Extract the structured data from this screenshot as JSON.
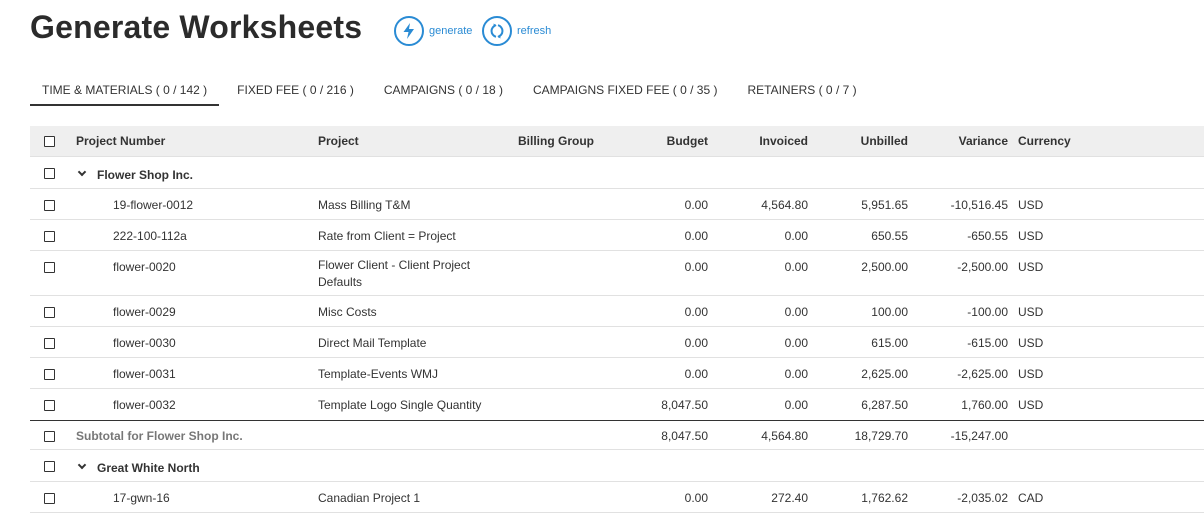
{
  "page": {
    "title": "Generate Worksheets"
  },
  "actions": {
    "generate": "generate",
    "refresh": "refresh"
  },
  "tabs": [
    {
      "label": "TIME & MATERIALS ( 0 / 142 )"
    },
    {
      "label": "FIXED FEE ( 0 / 216 )"
    },
    {
      "label": "CAMPAIGNS ( 0 / 18 )"
    },
    {
      "label": "CAMPAIGNS FIXED FEE ( 0 / 35 )"
    },
    {
      "label": "RETAINERS ( 0 / 7 )"
    }
  ],
  "table": {
    "columns": {
      "project_number": "Project Number",
      "project": "Project",
      "billing_group": "Billing Group",
      "budget": "Budget",
      "invoiced": "Invoiced",
      "unbilled": "Unbilled",
      "variance": "Variance",
      "currency": "Currency"
    },
    "groups": [
      {
        "name": "Flower Shop Inc.",
        "rows": [
          {
            "number": "19-flower-0012",
            "project": "Mass Billing T&M",
            "budget": "0.00",
            "invoiced": "4,564.80",
            "unbilled": "5,951.65",
            "variance": "-10,516.45",
            "currency": "USD"
          },
          {
            "number": "222-100-112a",
            "project": "Rate from Client = Project",
            "budget": "0.00",
            "invoiced": "0.00",
            "unbilled": "650.55",
            "variance": "-650.55",
            "currency": "USD"
          },
          {
            "number": "flower-0020",
            "project": "Flower Client - Client Project Defaults",
            "budget": "0.00",
            "invoiced": "0.00",
            "unbilled": "2,500.00",
            "variance": "-2,500.00",
            "currency": "USD"
          },
          {
            "number": "flower-0029",
            "project": "Misc Costs",
            "budget": "0.00",
            "invoiced": "0.00",
            "unbilled": "100.00",
            "variance": "-100.00",
            "currency": "USD"
          },
          {
            "number": "flower-0030",
            "project": "Direct Mail Template",
            "budget": "0.00",
            "invoiced": "0.00",
            "unbilled": "615.00",
            "variance": "-615.00",
            "currency": "USD"
          },
          {
            "number": "flower-0031",
            "project": "Template-Events WMJ",
            "budget": "0.00",
            "invoiced": "0.00",
            "unbilled": "2,625.00",
            "variance": "-2,625.00",
            "currency": "USD"
          },
          {
            "number": "flower-0032",
            "project": "Template Logo Single Quantity",
            "budget": "8,047.50",
            "invoiced": "0.00",
            "unbilled": "6,287.50",
            "variance": "1,760.00",
            "currency": "USD"
          }
        ],
        "subtotal": {
          "label": "Subtotal for Flower Shop Inc.",
          "budget": "8,047.50",
          "invoiced": "4,564.80",
          "unbilled": "18,729.70",
          "variance": "-15,247.00"
        }
      },
      {
        "name": "Great White North",
        "rows": [
          {
            "number": "17-gwn-16",
            "project": "Canadian Project 1",
            "budget": "0.00",
            "invoiced": "272.40",
            "unbilled": "1,762.62",
            "variance": "-2,035.02",
            "currency": "CAD"
          }
        ]
      }
    ]
  },
  "colors": {
    "accent": "#2a8bd4",
    "header_bg": "#efefef",
    "text": "#333333",
    "muted": "#777777"
  },
  "icons": {
    "generate": "bolt-icon",
    "refresh": "refresh-icon",
    "expand": "chevron-down-icon"
  }
}
